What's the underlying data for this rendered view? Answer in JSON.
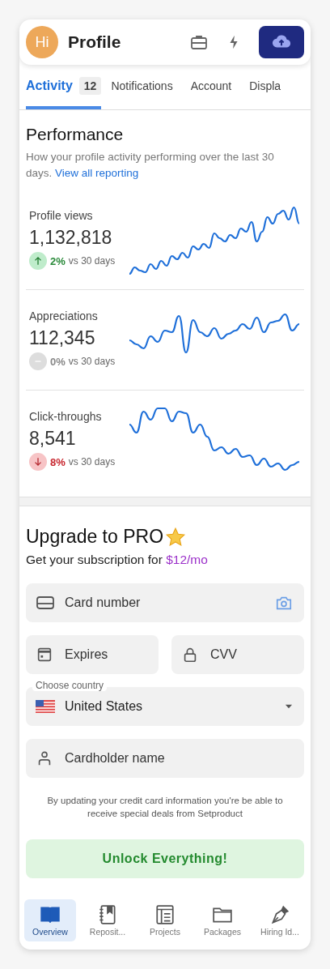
{
  "header": {
    "avatar": "Hi",
    "title": "Profile"
  },
  "tabs": [
    {
      "label": "Activity",
      "badge": "12",
      "selected": true
    },
    {
      "label": "Notifications",
      "selected": false
    },
    {
      "label": "Account",
      "selected": false
    },
    {
      "label": "Displa",
      "selected": false
    }
  ],
  "performance": {
    "title": "Performance",
    "description": "How your profile activity performing over the last 30 days.",
    "link": "View all reporting",
    "metrics": [
      {
        "label": "Profile views",
        "value": "1,132,818",
        "kind": "up",
        "change": "2%",
        "period": "vs 30 days"
      },
      {
        "label": "Appreciations",
        "value": "112,345",
        "kind": "flat",
        "change": "0%",
        "period": "vs 30 days"
      },
      {
        "label": "Click-throughs",
        "value": "8,541",
        "kind": "down",
        "change": "8%",
        "period": "vs 30 days"
      }
    ]
  },
  "upgrade": {
    "title": "Upgrade to PRO",
    "subtitle": "Get your subscription for",
    "price": "$12/mo",
    "fields": [
      {
        "kind": "card",
        "placeholder": "Card number"
      },
      {
        "kind": "expires",
        "placeholder": "Expires"
      },
      {
        "kind": "cvv",
        "placeholder": "CVV"
      }
    ],
    "country": {
      "label": "Choose country",
      "value": "United States"
    },
    "name_field": {
      "placeholder": "Cardholder name"
    },
    "note": "By updating your credit card information you're be able to receive special deals from Setproduct",
    "button": "Unlock Everything!"
  },
  "nav": [
    {
      "kind": "book",
      "label": "Overview",
      "selected": true
    },
    {
      "kind": "notebook",
      "label": "Reposit...",
      "selected": false
    },
    {
      "kind": "projects",
      "label": "Projects",
      "selected": false
    },
    {
      "kind": "folder",
      "label": "Packages",
      "selected": false
    },
    {
      "kind": "pen",
      "label": "Hiring Id...",
      "selected": false
    }
  ]
}
